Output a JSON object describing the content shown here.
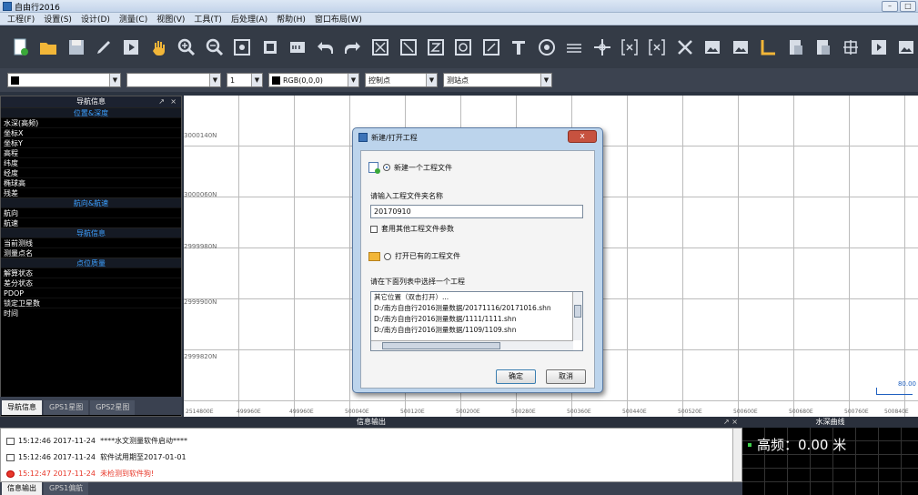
{
  "window": {
    "title": "自由行2016"
  },
  "menu": [
    "工程(F)",
    "设置(S)",
    "设计(D)",
    "测量(C)",
    "视图(V)",
    "工具(T)",
    "后处理(A)",
    "帮助(H)",
    "窗口布局(W)"
  ],
  "toolbar_icons": [
    "new-file-icon",
    "open-folder-icon",
    "save-icon",
    "edit-icon",
    "play-icon",
    "hand-icon",
    "zoom-in-icon",
    "zoom-out-icon",
    "zoom-extent-icon",
    "layer-icon",
    "scale-icon",
    "undo-icon",
    "redo-icon",
    "box-x-icon",
    "box-slash-icon",
    "box-z-icon",
    "circle-icon",
    "circle2-icon",
    "t-text-icon",
    "target-icon",
    "line-icon",
    "cross-icon",
    "bracket-x-icon",
    "bracket-x2-icon",
    "delete-x-icon",
    "image-icon",
    "image2-icon",
    "angle-icon",
    "doc-icon",
    "doc2-icon",
    "grid-icon",
    "next-icon",
    "image3-icon"
  ],
  "options": {
    "color_combo": "",
    "blank_combo": "",
    "number_combo": "1",
    "rgb_combo": "RGB(0,0,0)",
    "control_combo": "控制点",
    "measure_combo": "测站点"
  },
  "nav": {
    "title": "导航信息",
    "sections": [
      {
        "label": "位置&深度",
        "rows": [
          "水深(高频)",
          "坐标X",
          "坐标Y",
          "高程",
          "纬度",
          "经度",
          "椭球高",
          "残差"
        ]
      },
      {
        "label": "航向&航速",
        "rows": [
          "航向",
          "航速"
        ]
      },
      {
        "label": "导航信息",
        "rows": [
          "当前测线",
          "测量点名"
        ]
      },
      {
        "label": "点位质量",
        "rows": [
          "解算状态",
          "差分状态",
          "PDOP",
          "锁定卫星数",
          "时间"
        ]
      }
    ],
    "tabs": [
      "导航信息",
      "GPS1星图",
      "GPS2星图"
    ]
  },
  "canvas": {
    "y_labels": [
      "3000140N",
      "3000060N",
      "2999980N",
      "2999900N",
      "2999820N"
    ],
    "x_labels": [
      "2514800E",
      "499960E",
      "499960E",
      "500040E",
      "500120E",
      "500200E",
      "500280E",
      "500360E",
      "500440E",
      "500520E",
      "500600E",
      "500680E",
      "500760E",
      "500840E"
    ],
    "scale": "80.00"
  },
  "dialog": {
    "title": "新建/打开工程",
    "close": "x",
    "new_project": "新建一个工程文件",
    "input_label": "请输入工程文件夹名称",
    "input_value": "20170910",
    "reuse_params": "套用其他工程文件参数",
    "open_existing": "打开已有的工程文件",
    "list_label": "请在下面列表中选择一个工程",
    "list_items": [
      "其它位置（双击打开）...",
      "D:/南方自由行2016测量数据/20171116/20171016.shn",
      "D:/南方自由行2016测量数据/1111/1111.shn",
      "D:/南方自由行2016测量数据/1109/1109.shn"
    ],
    "ok": "确定",
    "cancel": "取消"
  },
  "info": {
    "title": "信息输出",
    "logs": [
      {
        "time": "15:12:46 2017-11-24",
        "msg": "****水文测量软件启动****",
        "type": "info"
      },
      {
        "time": "15:12:46 2017-11-24",
        "msg": "软件试用期至2017-01-01",
        "type": "info"
      },
      {
        "time": "15:12:47 2017-11-24",
        "msg": "未检测到软件狗!",
        "type": "error"
      }
    ],
    "tabs": [
      "信息输出",
      "GPS1偏航"
    ]
  },
  "water": {
    "title": "水深曲线",
    "freq_label": "高频：",
    "freq_value": "0.00",
    "unit": "米"
  }
}
